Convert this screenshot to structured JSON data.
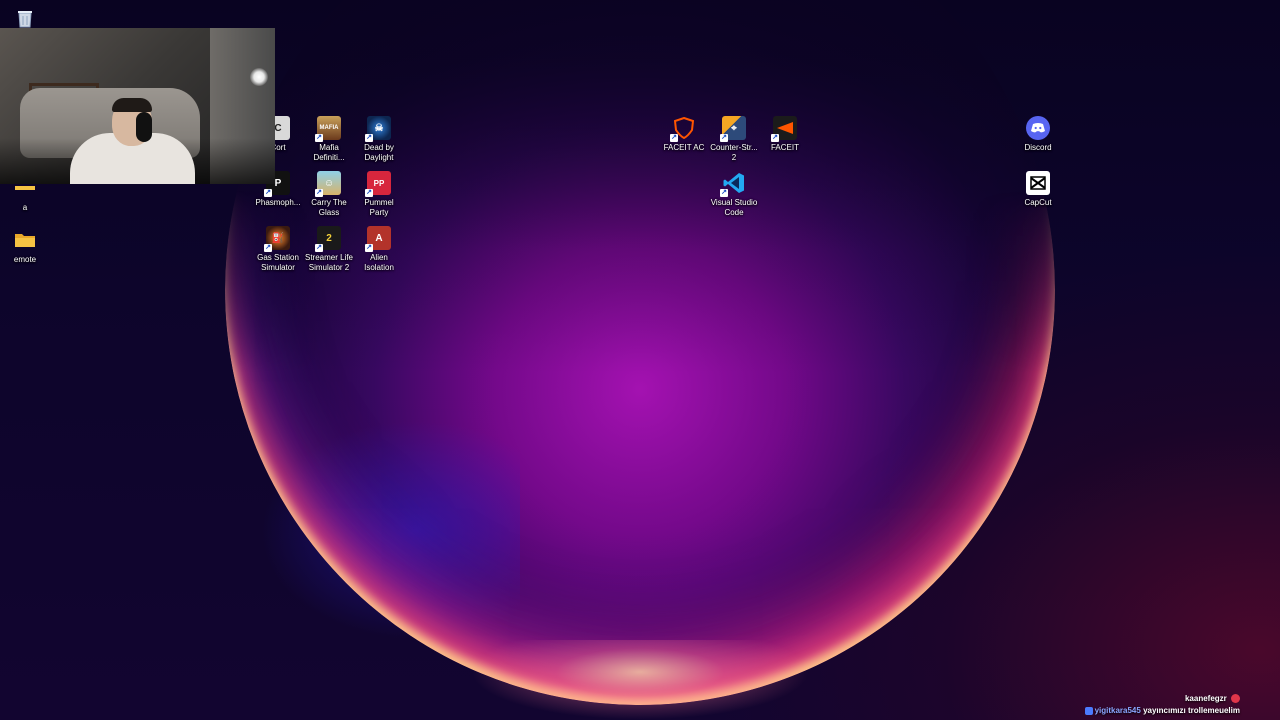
{
  "desktop": {
    "icons": {
      "recycle_bin": {
        "label": "",
        "icon": "recycle-bin-icon"
      },
      "a": {
        "label": "a",
        "icon": "folder-icon"
      },
      "emote": {
        "label": "emote",
        "icon": "folder-icon"
      },
      "cort": {
        "label": "Cort",
        "icon": "game-icon"
      },
      "mafia": {
        "label": "Mafia\nDefiniti...",
        "icon": "mafia-icon"
      },
      "dead_by_daylight": {
        "label": "Dead by\nDaylight",
        "icon": "dead-by-daylight-icon"
      },
      "phasmophobia": {
        "label": "Phasmoph...",
        "icon": "phasmophobia-icon"
      },
      "carry_the_glass": {
        "label": "Carry The\nGlass",
        "icon": "carry-the-glass-icon"
      },
      "pummel_party": {
        "label": "Pummel\nParty",
        "icon": "pummel-party-icon"
      },
      "gas_station": {
        "label": "Gas Station\nSimulator",
        "icon": "gas-station-icon"
      },
      "streamer_life": {
        "label": "Streamer Life\nSimulator 2",
        "icon": "streamer-life-icon"
      },
      "alien_isolation": {
        "label": "Alien\nIsolation",
        "icon": "alien-isolation-icon"
      },
      "faceit_ac": {
        "label": "FACEIT AC",
        "icon": "faceit-ac-icon"
      },
      "counter_strike": {
        "label": "Counter-Str...\n2",
        "icon": "counter-strike-icon"
      },
      "faceit": {
        "label": "FACEIT",
        "icon": "faceit-icon"
      },
      "vscode": {
        "label": "Visual Studio\nCode",
        "icon": "vscode-icon"
      },
      "discord": {
        "label": "Discord",
        "icon": "discord-icon"
      },
      "capcut": {
        "label": "CapCut",
        "icon": "capcut-icon"
      }
    }
  },
  "chat": {
    "messages": [
      {
        "user": "kaanefegzr",
        "message": ""
      },
      {
        "user": "yigitkara545",
        "message": "yayıncımızı trollemeuelim"
      }
    ]
  },
  "colors": {
    "wallpaper_bg": "#0a0424",
    "sphere_magenta": "#c014c8",
    "rim_orange": "#ffb070",
    "chat_user_blue": "#8aa6ff"
  }
}
